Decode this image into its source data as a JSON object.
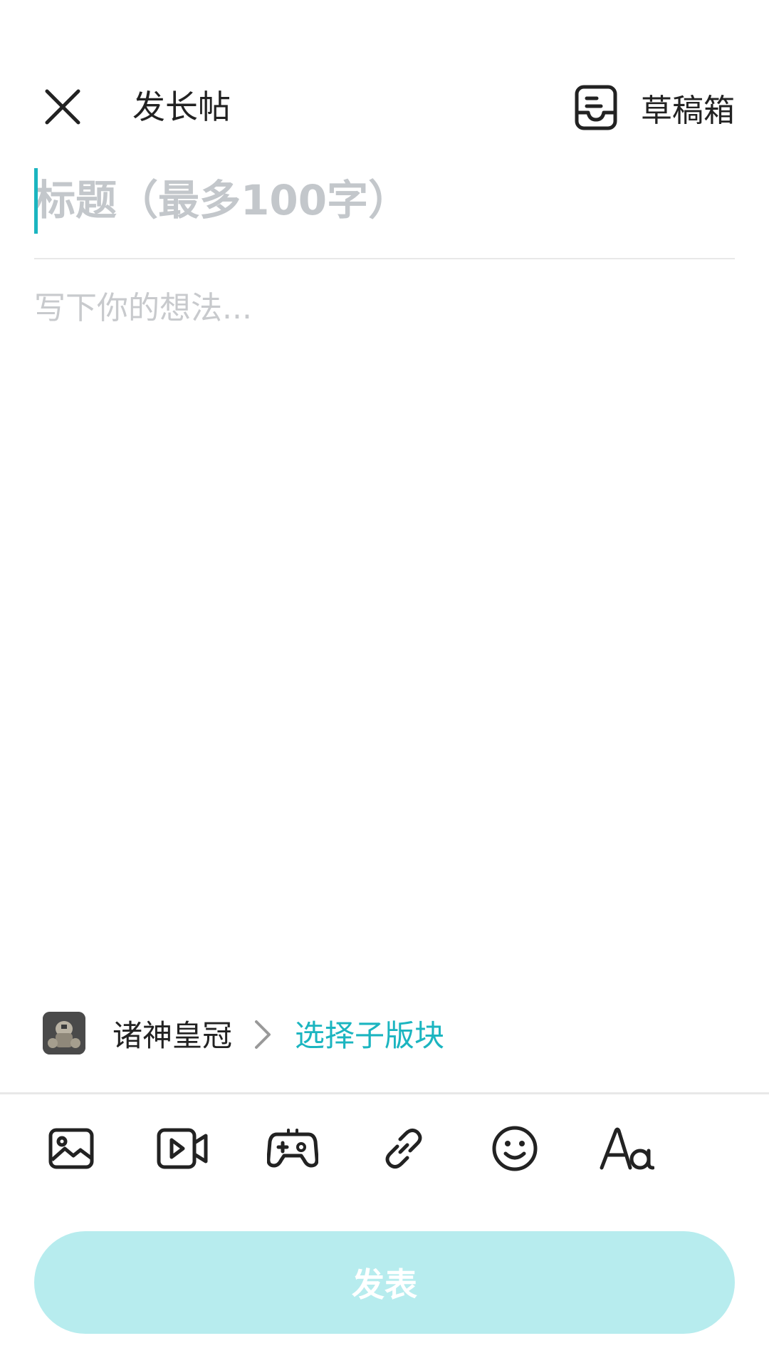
{
  "header": {
    "title": "发长帖",
    "draft_label": "草稿箱",
    "close_icon": "close-icon",
    "draft_icon": "drafts-inbox-icon"
  },
  "editor": {
    "title_placeholder": "标题（最多100字）",
    "title_value": "",
    "body_placeholder": "写下你的想法...",
    "body_value": ""
  },
  "forum": {
    "name": "诸神皇冠",
    "subforum_label": "选择子版块",
    "avatar_icon": "game-avatar"
  },
  "toolbar": {
    "items": [
      {
        "icon": "image-icon"
      },
      {
        "icon": "video-icon"
      },
      {
        "icon": "gamepad-icon"
      },
      {
        "icon": "link-icon"
      },
      {
        "icon": "emoji-icon"
      },
      {
        "icon": "text-format-icon"
      }
    ]
  },
  "publish": {
    "label": "发表",
    "enabled": false
  },
  "colors": {
    "accent": "#1BB5C0",
    "publish_disabled_bg": "#B7ECEE",
    "placeholder": "#C3C7CB",
    "divider": "#E8E8E8"
  }
}
